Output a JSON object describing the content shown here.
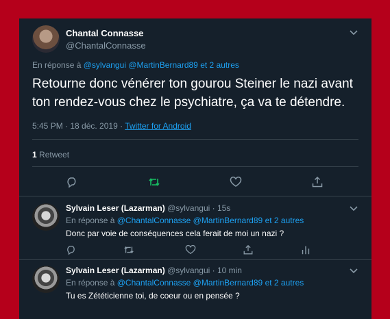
{
  "main_tweet": {
    "display_name": "Chantal Connasse",
    "handle": "@ChantalConnasse",
    "reply_prefix": "En réponse à",
    "reply_mentions": "@sylvangui @MartinBernard89",
    "reply_others": "et 2 autres",
    "text": "Retourne donc vénérer ton gourou Steiner le nazi avant ton rendez-vous chez le psychiatre, ça va te détendre.",
    "time": "5:45 PM · 18 déc. 2019 ·",
    "source": "Twitter for Android",
    "retweet_count": "1",
    "retweet_label": "Retweet"
  },
  "replies": [
    {
      "display_name": "Sylvain Leser (Lazarman)",
      "handle_time": "@sylvangui · 15s",
      "reply_prefix": "En réponse à",
      "reply_mentions": "@ChantalConnasse @MartinBernard89",
      "reply_others": "et 2 autres",
      "text": "Donc par voie de conséquences cela ferait de moi un nazi ?"
    },
    {
      "display_name": "Sylvain Leser (Lazarman)",
      "handle_time": "@sylvangui · 10 min",
      "reply_prefix": "En réponse à",
      "reply_mentions": "@ChantalConnasse @MartinBernard89",
      "reply_others": "et 2 autres",
      "text": "Tu es Zététicienne toi, de coeur ou en pensée ?"
    }
  ],
  "colors": {
    "background": "#b5001b",
    "panel": "#15202b",
    "link": "#1da1f2",
    "retweet": "#17bf63",
    "muted": "#8899a6"
  },
  "icons": [
    "reply-icon",
    "retweet-icon",
    "like-icon",
    "share-icon",
    "analytics-icon",
    "chevron-down-icon"
  ]
}
